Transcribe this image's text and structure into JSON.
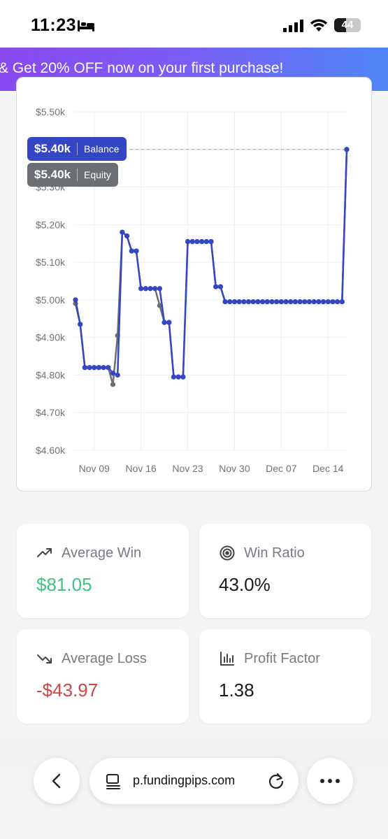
{
  "status": {
    "time": "11:23",
    "battery": "44",
    "battery_level": 0.44
  },
  "promo": {
    "text": "& Get 20% OFF now on your first purchase!"
  },
  "chart_data": {
    "type": "line",
    "y_ticks": [
      "$5.50k",
      "$5.40k",
      "$5.30k",
      "$5.20k",
      "$5.10k",
      "$5.00k",
      "$4.90k",
      "$4.80k",
      "$4.70k",
      "$4.60k"
    ],
    "x_ticks": [
      "Nov 09",
      "Nov 16",
      "Nov 23",
      "Nov 30",
      "Dec 07",
      "Dec 14"
    ],
    "ylim": [
      4600,
      5500
    ],
    "grid": true,
    "series": [
      {
        "name": "Balance",
        "color": "#3446c4",
        "values": [
          5000,
          4935,
          4820,
          4820,
          4820,
          4820,
          4820,
          4820,
          4805,
          4800,
          5180,
          5170,
          5130,
          5130,
          5030,
          5030,
          5030,
          5030,
          5030,
          4940,
          4940,
          4795,
          4795,
          4795,
          5155,
          5155,
          5155,
          5155,
          5155,
          5155,
          5035,
          5035,
          4995,
          4995,
          4995,
          4995,
          4995,
          4995,
          4995,
          4995,
          4995,
          4995,
          4995,
          4995,
          4995,
          4995,
          4995,
          4995,
          4995,
          4995,
          4995,
          4995,
          4995,
          4995,
          4995,
          4995,
          4995,
          4995,
          5400
        ]
      },
      {
        "name": "Equity",
        "color": "#6b6e73",
        "values": [
          4990,
          4935,
          4820,
          4820,
          4820,
          4820,
          4820,
          4820,
          4775,
          4905,
          5180,
          5170,
          5130,
          5130,
          5030,
          5030,
          5030,
          5030,
          4985,
          4940,
          4940,
          4795,
          4795,
          4795,
          5155,
          5155,
          5155,
          5155,
          5155,
          5155,
          5035,
          5035,
          4995,
          4995,
          4995,
          4995,
          4995,
          4995,
          4995,
          4995,
          4995,
          4995,
          4995,
          4995,
          4995,
          4995,
          4995,
          4995,
          4995,
          4995,
          4995,
          4995,
          4995,
          4995,
          4995,
          4995,
          4995,
          4995,
          5400
        ]
      }
    ],
    "tooltip": {
      "balance_value": "$5.40k",
      "balance_label": "Balance",
      "equity_value": "$5.40k",
      "equity_label": "Equity"
    }
  },
  "stats": {
    "average_win": {
      "label": "Average Win",
      "value": "$81.05",
      "icon": "trending-up-icon"
    },
    "win_ratio": {
      "label": "Win Ratio",
      "value": "43.0%",
      "icon": "target-icon"
    },
    "average_loss": {
      "label": "Average Loss",
      "value": "-$43.97",
      "icon": "trending-down-icon"
    },
    "profit_factor": {
      "label": "Profit Factor",
      "value": "1.38",
      "icon": "bar-chart-icon"
    }
  },
  "browser": {
    "url": "p.fundingpips.com"
  },
  "colors": {
    "balance": "#3446c4",
    "equity": "#6b6e73",
    "positive": "#3ec47e",
    "negative": "#d14545"
  }
}
